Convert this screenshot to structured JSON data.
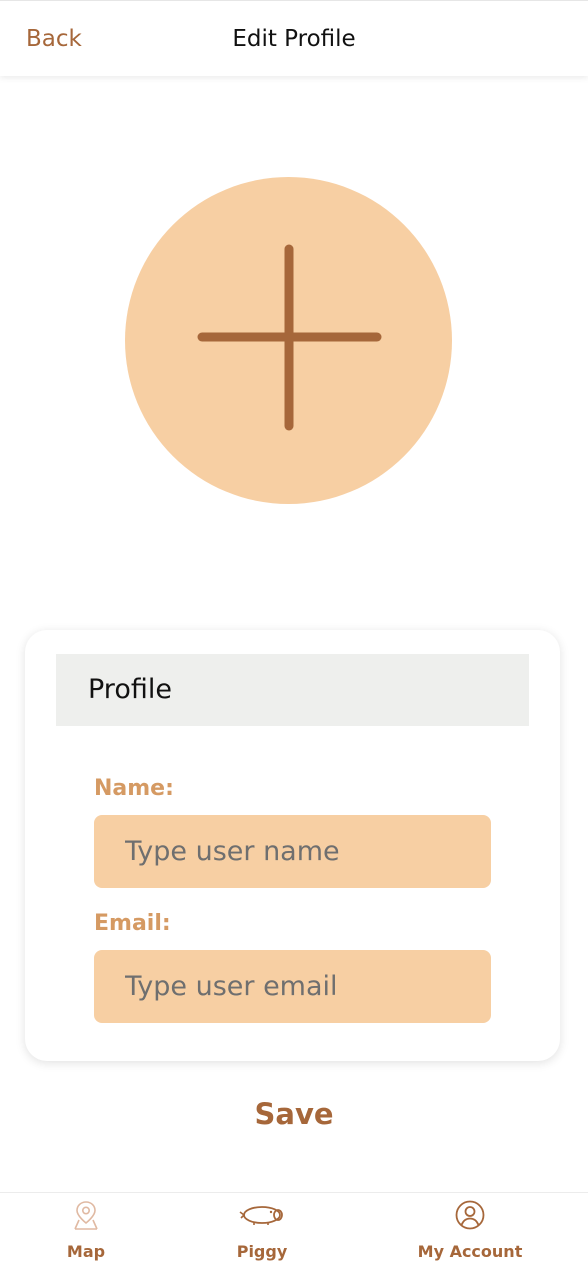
{
  "header": {
    "back_label": "Back",
    "title": "Edit Profile"
  },
  "avatar": {
    "icon": "plus-icon"
  },
  "profile_card": {
    "title": "Profile",
    "name_label": "Name:",
    "name_placeholder": "Type user name",
    "name_value": "",
    "email_label": "Email:",
    "email_placeholder": "Type user email",
    "email_value": ""
  },
  "save_label": "Save",
  "bottom_nav": {
    "items": [
      {
        "label": "Map",
        "icon": "map-pin-icon"
      },
      {
        "label": "Piggy",
        "icon": "piggy-icon"
      },
      {
        "label": "My Account",
        "icon": "user-circle-icon"
      }
    ]
  },
  "colors": {
    "accent_brown": "#a6673a",
    "peach": "#f7cfa3",
    "label_tan": "#d59a63",
    "card_header_gray": "#eeefed"
  }
}
